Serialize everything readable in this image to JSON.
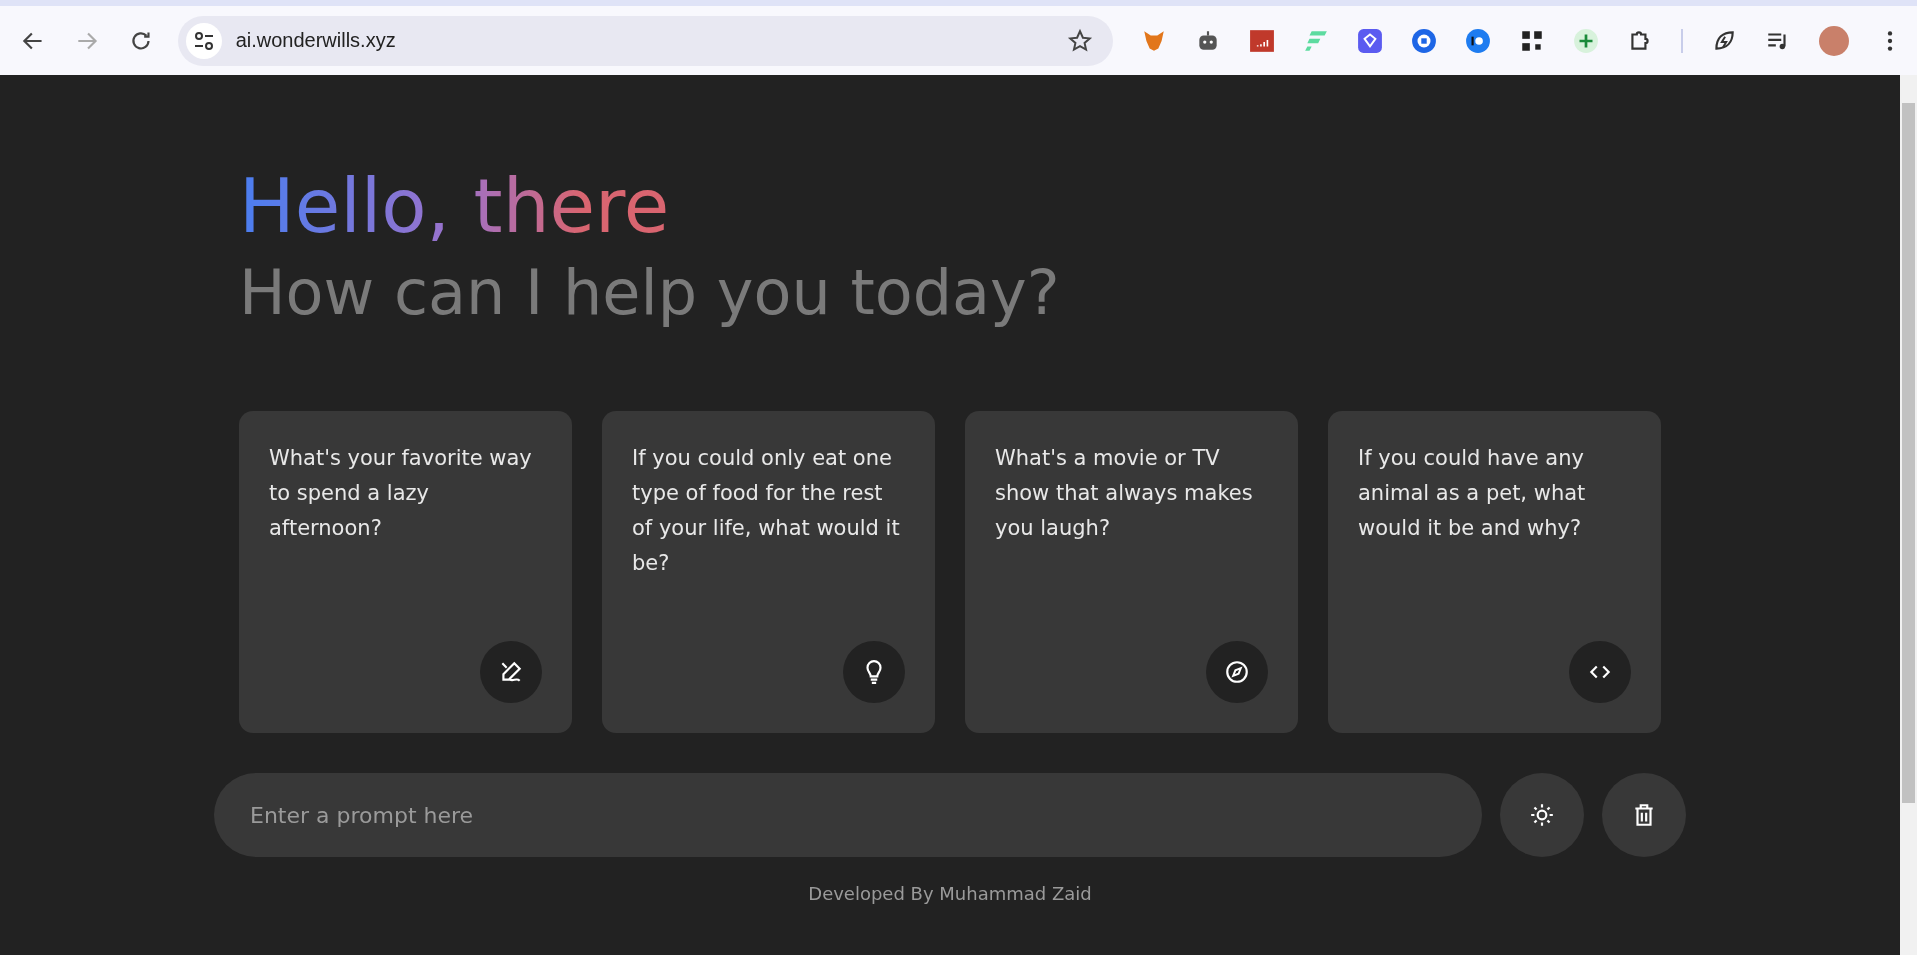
{
  "browser": {
    "url": "ai.wonderwills.xyz"
  },
  "header": {
    "title": "Hello, there",
    "subtitle": "How can I help you today?"
  },
  "suggestions": [
    {
      "text": "What's your favorite way to spend a lazy afternoon?",
      "kind": "pencil"
    },
    {
      "text": "If you could only eat one type of food for the rest of your life, what would it be?",
      "kind": "bulb"
    },
    {
      "text": "What's a movie or TV show that always makes you laugh?",
      "kind": "compass"
    },
    {
      "text": "If you could have any animal as a pet, what would it be and why?",
      "kind": "code"
    }
  ],
  "prompt": {
    "placeholder": "Enter a prompt here"
  },
  "footer": "Developed By Muhammad Zaid"
}
